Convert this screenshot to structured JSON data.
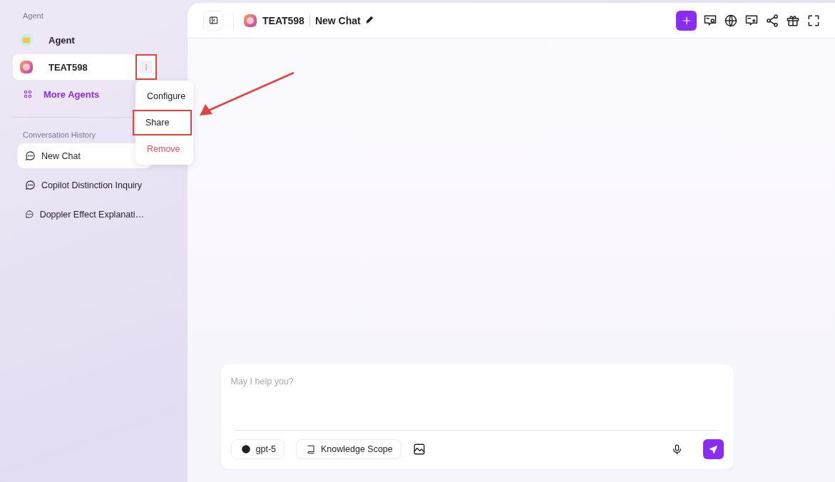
{
  "sidebar": {
    "agent_label": "Agent",
    "agents": [
      {
        "name": "Agent",
        "selected": false,
        "kind": "folder"
      },
      {
        "name": "TEAT598",
        "selected": true,
        "kind": "avatar",
        "menu_highlighted": true
      }
    ],
    "more_agents": "More Agents",
    "history_label": "Conversation History",
    "conversations": [
      {
        "title": "New Chat",
        "selected": true
      },
      {
        "title": "Copilot Distinction Inquiry",
        "selected": false
      },
      {
        "title": "Doppler Effect Explanati…",
        "selected": false
      }
    ]
  },
  "context_menu": [
    {
      "label": "Configure",
      "kind": "normal",
      "highlighted": false
    },
    {
      "label": "Share",
      "kind": "normal",
      "highlighted": true
    },
    {
      "label": "Remove",
      "kind": "danger",
      "highlighted": false
    }
  ],
  "header": {
    "agent_name": "TEAT598",
    "chat_title": "New Chat"
  },
  "composer": {
    "placeholder": "May I help you?",
    "model": "gpt-5",
    "knowledge": "Knowledge Scope"
  }
}
